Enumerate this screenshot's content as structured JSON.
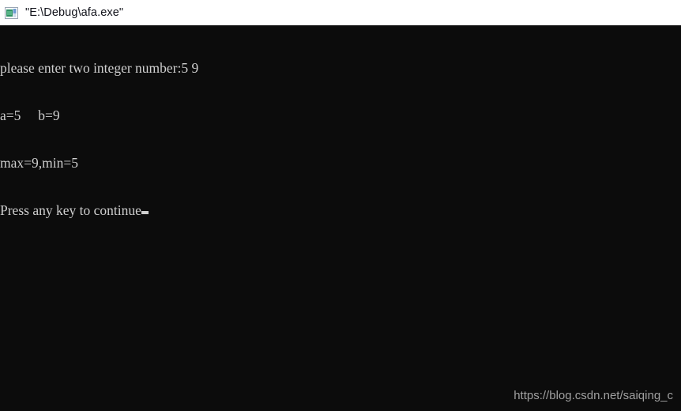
{
  "window": {
    "title": "\"E:\\Debug\\afa.exe\"",
    "icon": "console-window-icon",
    "icon_colors": {
      "frame": "#b9c3cf",
      "fill_green": "#2e8b57",
      "fill_blue": "#4a7ebb",
      "fill_light": "#d7e3ef"
    }
  },
  "theme": {
    "titlebar_background": "#ffffff",
    "titlebar_text": "#11121a",
    "console_background": "#0c0c0c",
    "console_text": "#cfcfcf",
    "watermark_text": "#a0a0a0"
  },
  "console": {
    "lines": [
      "please enter two integer number:5 9",
      "a=5     b=9",
      "max=9,min=5",
      "Press any key to continue"
    ],
    "line_1": "please enter two integer number:5 9",
    "line_2": "a=5     b=9",
    "line_3": "max=9,min=5",
    "line_4": "Press any key to continue",
    "cursor": "block-cursor",
    "prompt_text": "please enter two integer number:",
    "input_values": "5 9",
    "variable_a": "a=5",
    "variable_b": "b=9",
    "result_max": "max=9",
    "result_min": "min=5",
    "continue_prompt": "Press any key to continue"
  },
  "watermark": {
    "text": "https://blog.csdn.net/saiqing_c"
  }
}
